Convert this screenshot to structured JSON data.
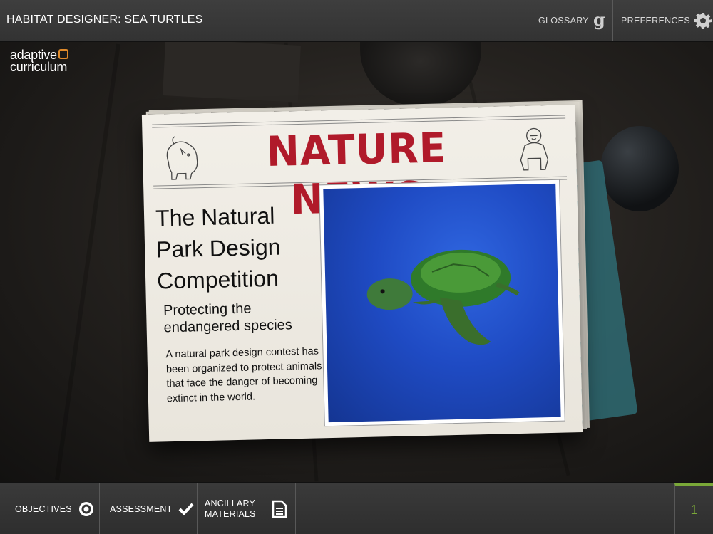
{
  "header": {
    "title": "HABITAT DESIGNER: SEA TURTLES",
    "glossary_label": "GLOSSARY",
    "preferences_label": "PREFERENCES"
  },
  "logo": {
    "line1": "adaptive",
    "line2": "curriculum"
  },
  "newspaper": {
    "masthead": "NATURE NEWS",
    "headline": "The Natural Park Design Competition",
    "subhead": "Protecting the endangered species",
    "body": "A natural park design contest has been organized to protect animals that face the danger of becoming extinct in the world."
  },
  "footer": {
    "objectives_label": "OBJECTIVES",
    "assessment_label": "ASSESSMENT",
    "ancillary_line1": "ANCILLARY",
    "ancillary_line2": "MATERIALS",
    "page_number": "1"
  },
  "colors": {
    "masthead": "#b01a2a",
    "page_accent": "#7aa838",
    "photo_blue": "#1f4bc4"
  },
  "icons": [
    "g-glossary-icon",
    "gear-icon",
    "target-icon",
    "checkmark-icon",
    "document-icon",
    "rhino-icon",
    "gorilla-icon"
  ]
}
